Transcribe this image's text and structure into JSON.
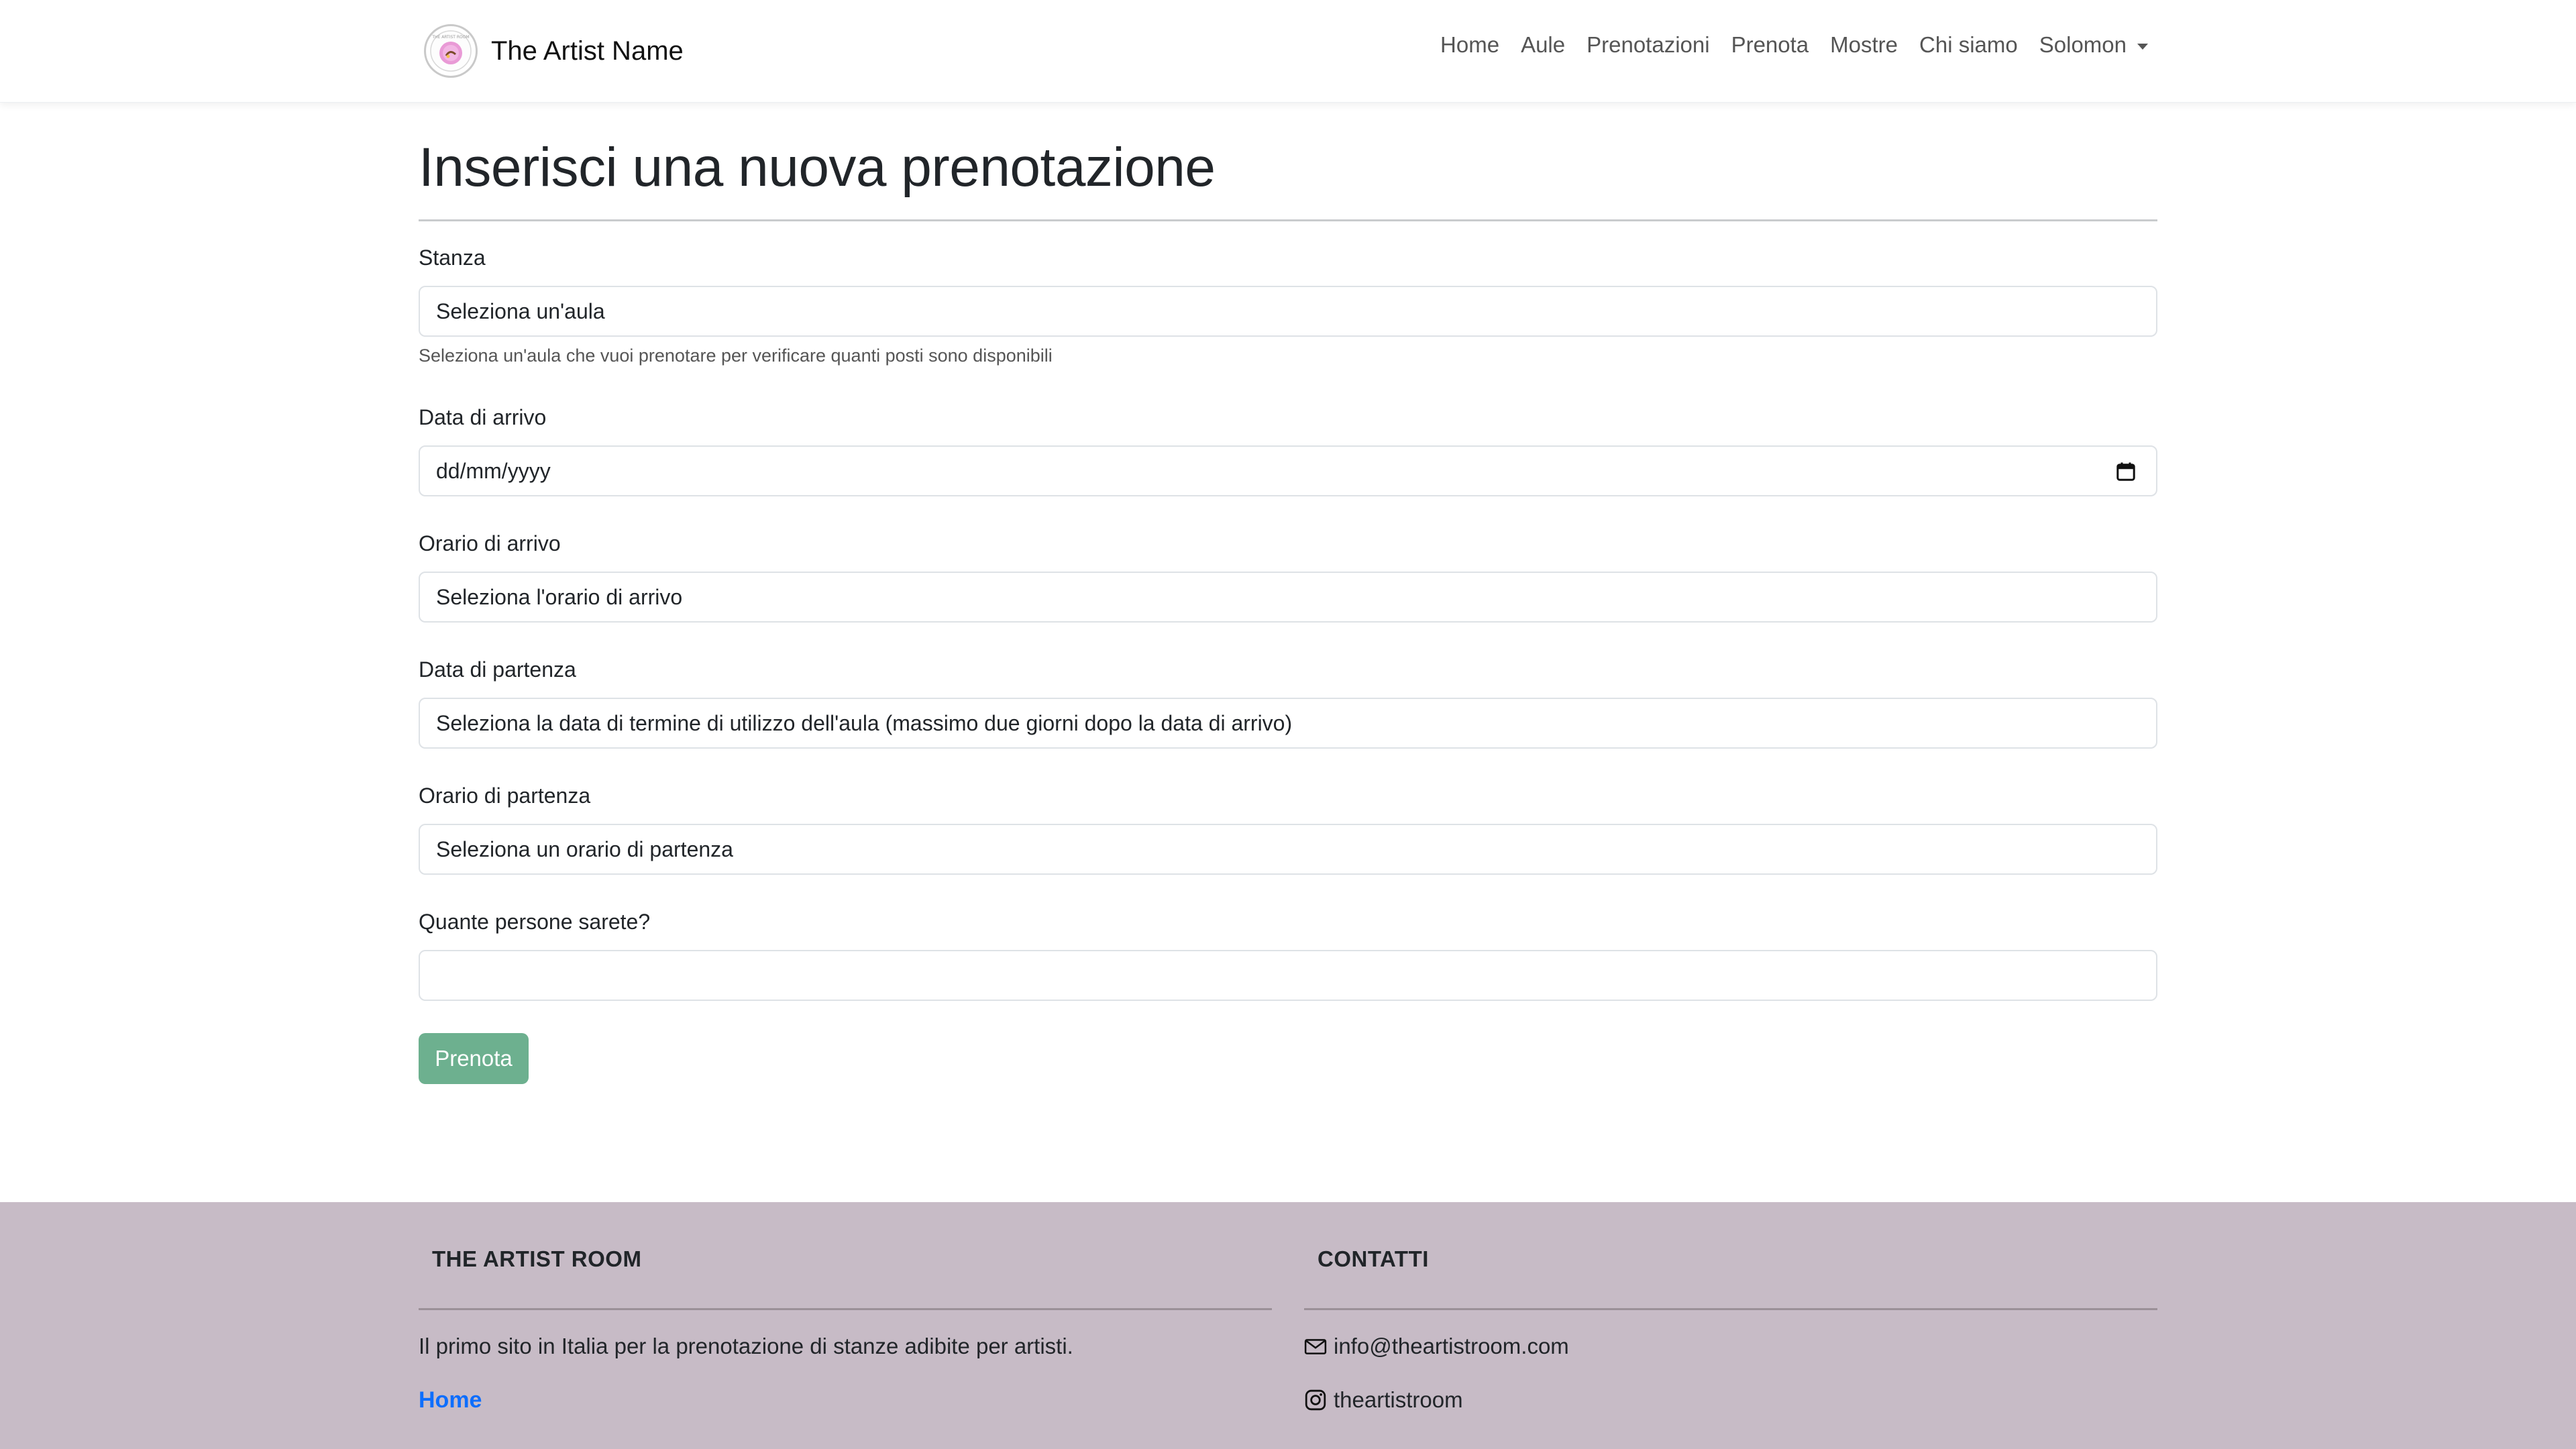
{
  "navbar": {
    "brand_name": "The Artist Name",
    "logo": "artist-room-logo",
    "links": [
      "Home",
      "Aule",
      "Prenotazioni",
      "Prenota",
      "Mostre",
      "Chi siamo"
    ],
    "user_menu": "Solomon"
  },
  "page": {
    "title": "Inserisci una nuova prenotazione"
  },
  "form": {
    "room": {
      "label": "Stanza",
      "selected": "Seleziona un'aula",
      "help": "Seleziona un'aula che vuoi prenotare per verificare quanti posti sono disponibili"
    },
    "arrival_date": {
      "label": "Data di arrivo",
      "placeholder": "dd/mm/yyyy"
    },
    "arrival_time": {
      "label": "Orario di arrivo",
      "selected": "Seleziona l'orario di arrivo"
    },
    "departure_date": {
      "label": "Data di partenza",
      "selected": "Seleziona la data di termine di utilizzo dell'aula (massimo due giorni dopo la data di arrivo)"
    },
    "departure_time": {
      "label": "Orario di partenza",
      "selected": "Seleziona un orario di partenza"
    },
    "people": {
      "label": "Quante persone sarete?",
      "value": ""
    },
    "submit_label": "Prenota"
  },
  "footer": {
    "about": {
      "heading": "THE ARTIST ROOM",
      "text": "Il primo sito in Italia per la prenotazione di stanze adibite per artisti.",
      "links": [
        "Home"
      ]
    },
    "contacts": {
      "heading": "CONTATTI",
      "email": "info@theartistroom.com",
      "instagram": "theartistroom"
    }
  },
  "colors": {
    "primary_link": "#0d6efd",
    "submit_button": "#6db08f",
    "footer_bg": "#c7bbc6"
  }
}
